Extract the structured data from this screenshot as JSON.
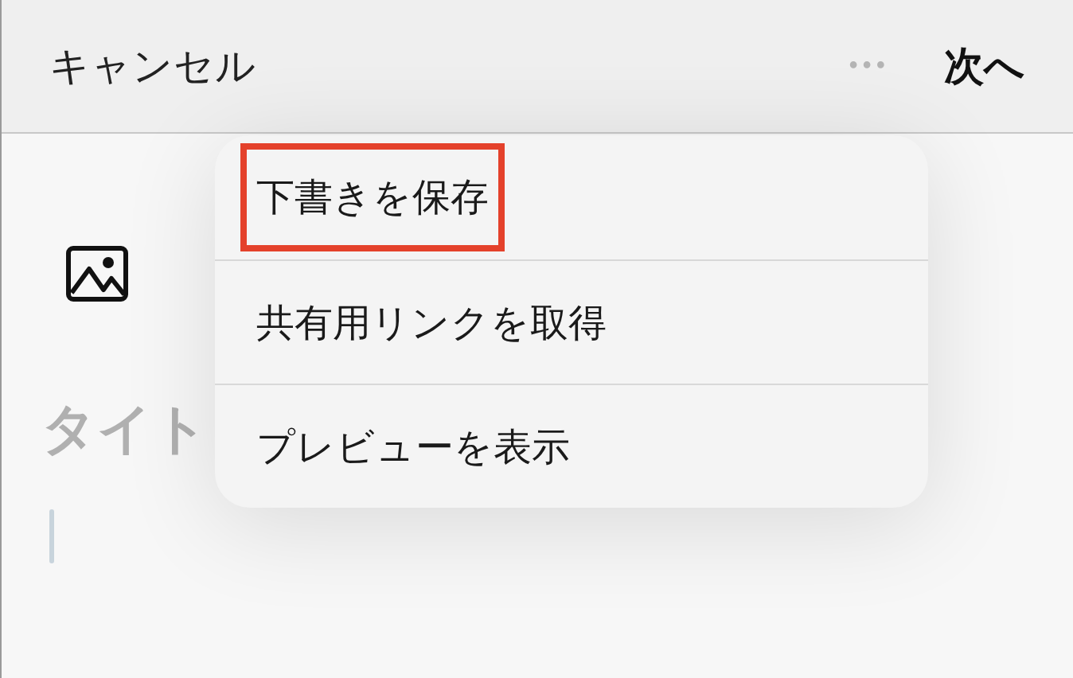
{
  "header": {
    "cancel": "キャンセル",
    "more": "•••",
    "next": "次へ"
  },
  "editor": {
    "title_field": {
      "placeholder": "タイト"
    }
  },
  "menu": {
    "items": [
      {
        "label": "下書きを保存",
        "highlighted": true
      },
      {
        "label": "共有用リンクを取得",
        "highlighted": false
      },
      {
        "label": "プレビューを表示",
        "highlighted": false
      }
    ]
  }
}
